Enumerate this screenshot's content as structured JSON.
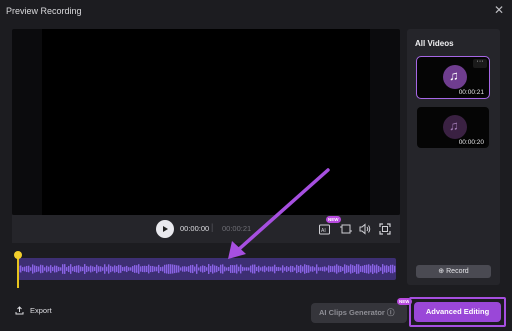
{
  "window": {
    "title": "Preview Recording",
    "close_glyph": "✕"
  },
  "player": {
    "current_time": "00:00:00",
    "separator": "|",
    "total_time": "00:00:21",
    "ai_badge": "NEW"
  },
  "sidebar": {
    "title": "All Videos",
    "videos": [
      {
        "duration": "00:00:21",
        "selected": true,
        "more_glyph": "···"
      },
      {
        "duration": "00:00:20",
        "selected": false
      }
    ],
    "record_label": "Record",
    "record_glyph": "⊕"
  },
  "footer": {
    "export_label": "Export",
    "ai_clips_label": "AI Clips Generator",
    "ai_clips_info_glyph": "ⓘ",
    "ai_clips_badge": "NEW",
    "advanced_label": "Advanced Editing"
  },
  "colors": {
    "accent": "#9a47d8",
    "playhead": "#f2ce2c",
    "waveform": "#8a63e6",
    "annotation_arrow": "#a64fe0"
  }
}
